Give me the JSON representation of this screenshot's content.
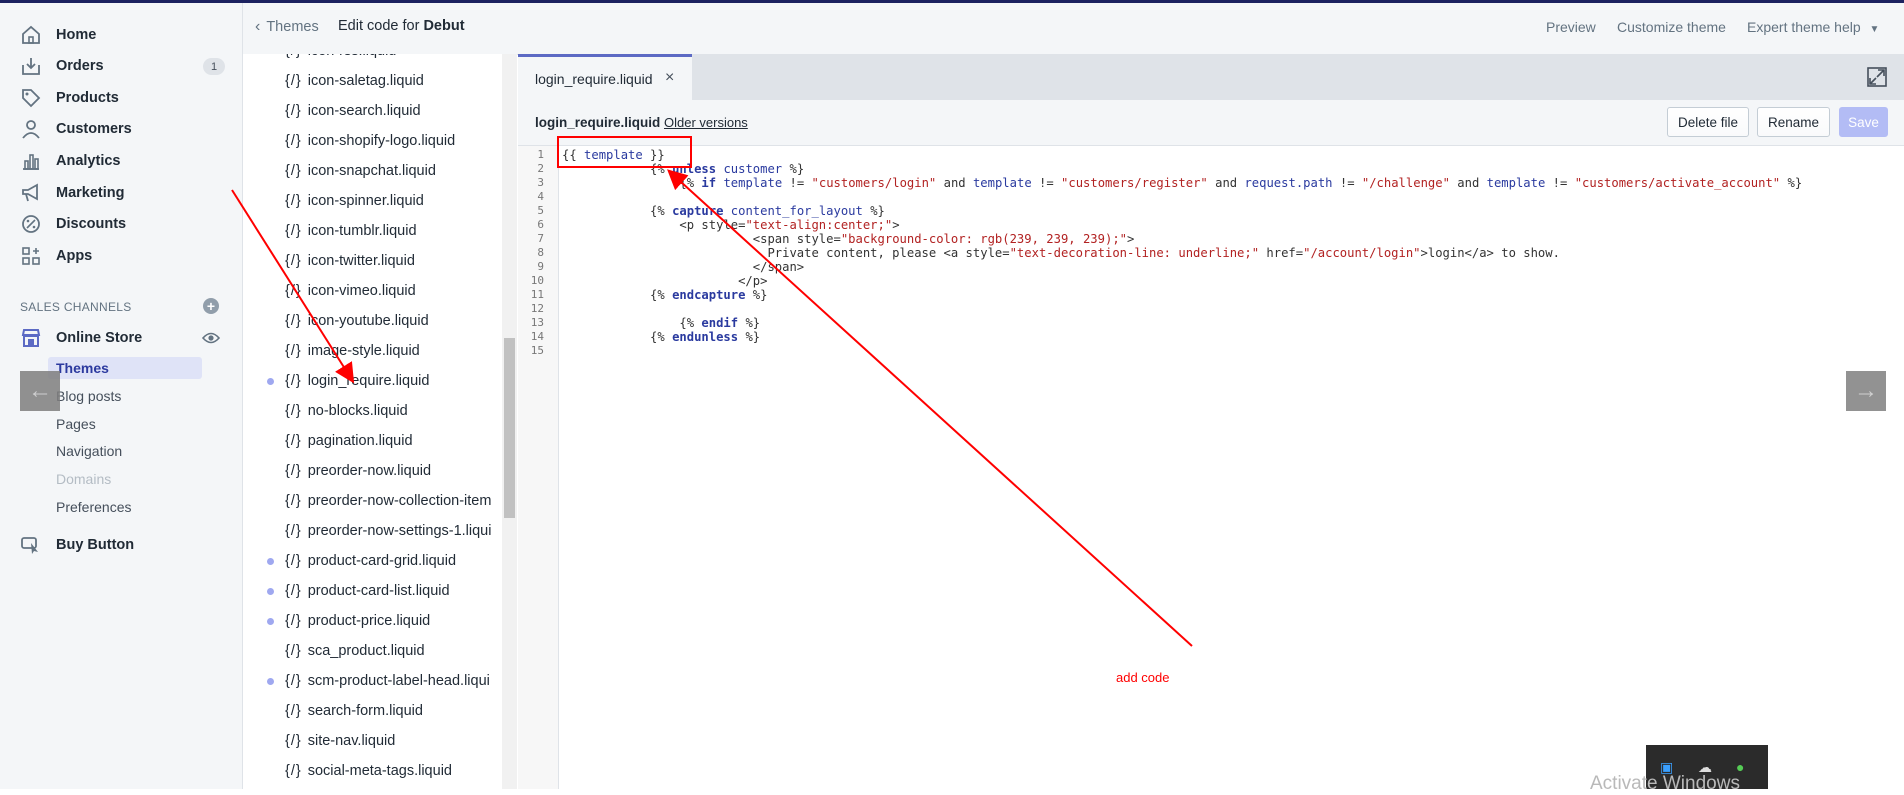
{
  "nav": {
    "items": [
      {
        "label": "Home",
        "icon": "home-icon"
      },
      {
        "label": "Orders",
        "icon": "orders-icon"
      },
      {
        "label": "Products",
        "icon": "tag-icon"
      },
      {
        "label": "Customers",
        "icon": "person-icon"
      },
      {
        "label": "Analytics",
        "icon": "bar-chart-icon"
      },
      {
        "label": "Marketing",
        "icon": "megaphone-icon"
      },
      {
        "label": "Discounts",
        "icon": "discount-icon"
      },
      {
        "label": "Apps",
        "icon": "apps-icon"
      }
    ],
    "orders_badge": "1",
    "sales_channels_heading": "SALES CHANNELS",
    "online_store": "Online Store",
    "sub_items": [
      "Themes",
      "Blog posts",
      "Pages",
      "Navigation",
      "Domains",
      "Preferences"
    ],
    "buy_button": "Buy Button"
  },
  "header": {
    "back_label": "Themes",
    "edit_prefix": "Edit code for",
    "theme_name": "Debut",
    "preview": "Preview",
    "customize": "Customize theme",
    "expert_help": "Expert theme help"
  },
  "files": [
    {
      "name": "icon-rss.liquid",
      "dot": false
    },
    {
      "name": "icon-saletag.liquid",
      "dot": false
    },
    {
      "name": "icon-search.liquid",
      "dot": false
    },
    {
      "name": "icon-shopify-logo.liquid",
      "dot": false
    },
    {
      "name": "icon-snapchat.liquid",
      "dot": false
    },
    {
      "name": "icon-spinner.liquid",
      "dot": false
    },
    {
      "name": "icon-tumblr.liquid",
      "dot": false
    },
    {
      "name": "icon-twitter.liquid",
      "dot": false
    },
    {
      "name": "icon-vimeo.liquid",
      "dot": false
    },
    {
      "name": "icon-youtube.liquid",
      "dot": false
    },
    {
      "name": "image-style.liquid",
      "dot": false
    },
    {
      "name": "login_require.liquid",
      "dot": true
    },
    {
      "name": "no-blocks.liquid",
      "dot": false
    },
    {
      "name": "pagination.liquid",
      "dot": false
    },
    {
      "name": "preorder-now.liquid",
      "dot": false
    },
    {
      "name": "preorder-now-collection-item",
      "dot": false
    },
    {
      "name": "preorder-now-settings-1.liqui",
      "dot": false
    },
    {
      "name": "product-card-grid.liquid",
      "dot": true
    },
    {
      "name": "product-card-list.liquid",
      "dot": true
    },
    {
      "name": "product-price.liquid",
      "dot": true
    },
    {
      "name": "sca_product.liquid",
      "dot": false
    },
    {
      "name": "scm-product-label-head.liqui",
      "dot": true
    },
    {
      "name": "search-form.liquid",
      "dot": false
    },
    {
      "name": "site-nav.liquid",
      "dot": false
    },
    {
      "name": "social-meta-tags.liquid",
      "dot": false
    }
  ],
  "file_brace": "{/}",
  "editor": {
    "tab_label": "login_require.liquid",
    "tab_close": "×",
    "file_name": "login_require.liquid",
    "older_versions": "Older versions",
    "delete": "Delete file",
    "rename": "Rename",
    "save": "Save"
  },
  "code_lines": [
    "{{ template }}",
    "            {% unless customer %}",
    "                {% if template != \"customers/login\" and template != \"customers/register\" and request.path != \"/challenge\" and template != \"customers/activate_account\" %}",
    "",
    "            {% capture content_for_layout %}",
    "                <p style=\"text-align:center;\">",
    "                          <span style=\"background-color: rgb(239, 239, 239);\">",
    "                            Private content, please <a style=\"text-decoration-line: underline;\" href=\"/account/login\">login</a> to show.",
    "                          </span>",
    "                        </p>",
    "            {% endcapture %}",
    "",
    "                {% endif %}",
    "            {% endunless %}",
    ""
  ],
  "annotation_note": "add code",
  "watermark": "Activate Windows"
}
